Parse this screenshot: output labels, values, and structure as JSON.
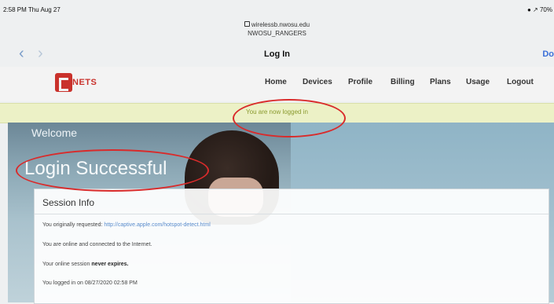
{
  "status_bar": {
    "time": "2:58 PM  Thu Aug 27",
    "battery": "● ↗ 70%"
  },
  "browser": {
    "url_host": "wirelessb.nwosu.edu",
    "url_sub": "NWOSU_RANGERS",
    "page_title": "Log In",
    "done_label": "Do"
  },
  "site": {
    "logo_text": "NETS",
    "menu": [
      "Home",
      "Devices",
      "Profile",
      "Billing",
      "Plans",
      "Usage",
      "Logout"
    ]
  },
  "notice": "You are now logged in",
  "hero": {
    "welcome": "Welcome",
    "heading": "Login Successful"
  },
  "session": {
    "title": "Session Info",
    "requested_prefix": "You originally requested:",
    "requested_link": "http://captive.apple.com/hotspot-detect.html",
    "connected": "You are online and connected to the Internet.",
    "expires_prefix": "Your online session",
    "expires_value": "never expires.",
    "logged_in": "You logged in on 08/27/2020 02:58 PM"
  },
  "colors": {
    "brand": "#c9312b",
    "notice_bg": "#ecf1c6",
    "link": "#5a8ccc",
    "annotation": "#d92b2b"
  }
}
